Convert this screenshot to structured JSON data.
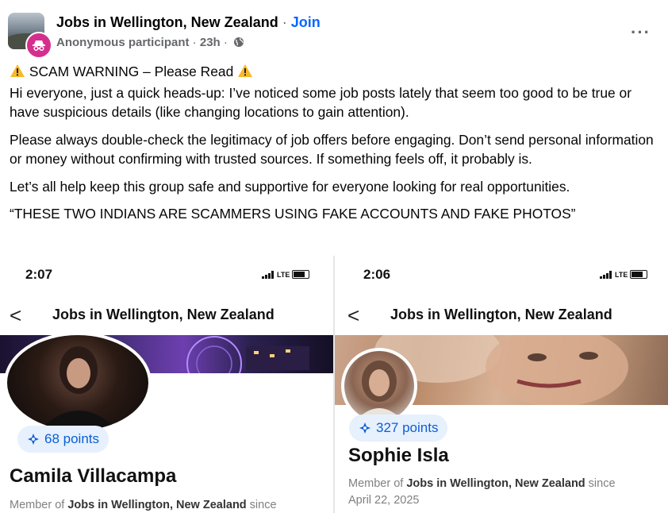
{
  "post": {
    "group_name": "Jobs in Wellington, New Zealand",
    "separator": " · ",
    "join_label": "Join",
    "author": "Anonymous participant",
    "time": "23h",
    "more_label": "···",
    "heading": "SCAM WARNING – Please Read",
    "p1": "Hi everyone, just a quick heads-up: I’ve noticed some job posts lately that seem too good to be true or have suspicious details (like changing locations to gain attention).",
    "p2": "Please always double-check the legitimacy of job offers before engaging. Don’t send personal information or money without confirming with trusted sources. If something feels off, it probably is.",
    "p3": "Let’s all help keep this group safe and supportive for everyone looking for real opportunities.",
    "p4": "“THESE TWO INDIANS ARE SCAMMERS USING FAKE ACCOUNTS AND FAKE PHOTOS”"
  },
  "screenshots": [
    {
      "time": "2:07",
      "network": "LTE",
      "back": "<",
      "nav_title": "Jobs in Wellington, New Zealand",
      "points": "68 points",
      "name": "Camila Villacampa",
      "member_prefix": "Member of ",
      "member_group": "Jobs in Wellington, New Zealand",
      "member_suffix": " since",
      "member_date": ""
    },
    {
      "time": "2:06",
      "network": "LTE",
      "back": "<",
      "nav_title": "Jobs in Wellington, New Zealand",
      "points": "327 points",
      "name": "Sophie Isla",
      "member_prefix": "Member of ",
      "member_group": "Jobs in Wellington, New Zealand",
      "member_suffix": " since",
      "member_date": "April 22, 2025"
    }
  ],
  "colors": {
    "accent": "#0866ff",
    "badge": "#d52f8e",
    "points_bg": "#e7f0fd",
    "points_text": "#0a5fd6"
  }
}
